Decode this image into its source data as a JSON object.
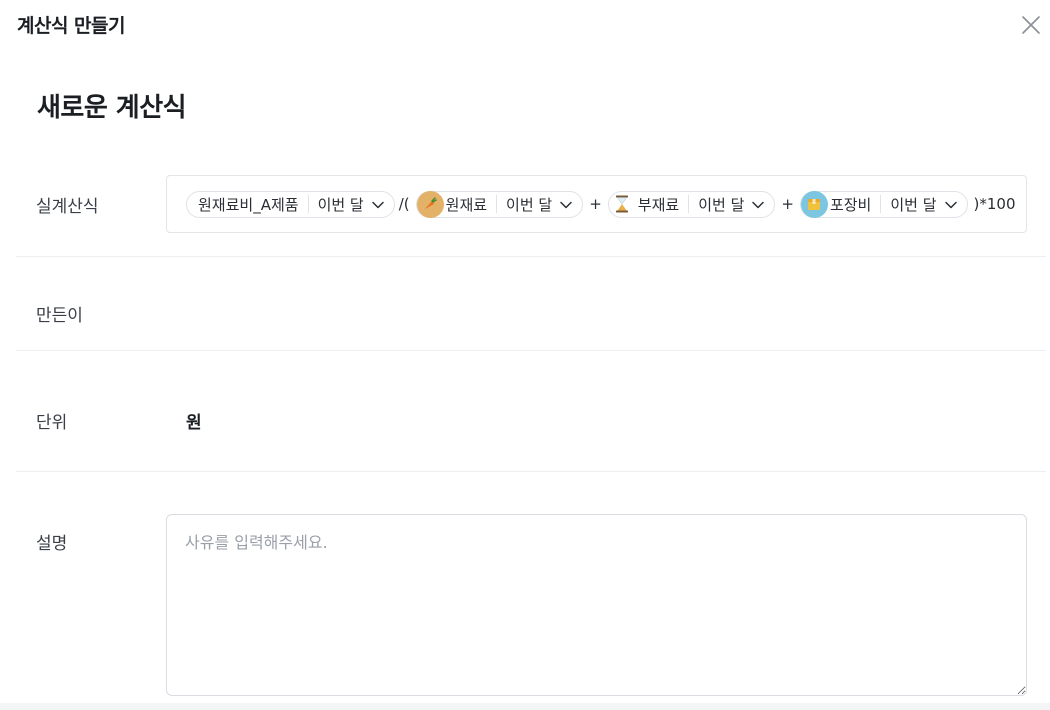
{
  "modal": {
    "title": "계산식 만들기"
  },
  "page": {
    "title": "새로운 계산식"
  },
  "labels": {
    "formula": "실계산식",
    "creator": "만든이",
    "unit": "단위",
    "description": "설명"
  },
  "formula": {
    "items": [
      {
        "kind": "chip",
        "name": "원재료비_A제품",
        "period": "이번 달",
        "icon": ""
      },
      {
        "kind": "op",
        "text": "/("
      },
      {
        "kind": "chip",
        "name": "원재료",
        "period": "이번 달",
        "icon": "carrot-icon"
      },
      {
        "kind": "op",
        "text": "+"
      },
      {
        "kind": "chip",
        "name": "부재료",
        "period": "이번 달",
        "icon": "hourglass-icon"
      },
      {
        "kind": "op",
        "text": "+"
      },
      {
        "kind": "chip",
        "name": "포장비",
        "period": "이번 달",
        "icon": "box-icon"
      },
      {
        "kind": "op",
        "text": ")*100"
      }
    ]
  },
  "creator": {
    "value": ""
  },
  "unit": {
    "value": "원"
  },
  "description": {
    "value": "",
    "placeholder": "사유를 입력해주세요."
  }
}
